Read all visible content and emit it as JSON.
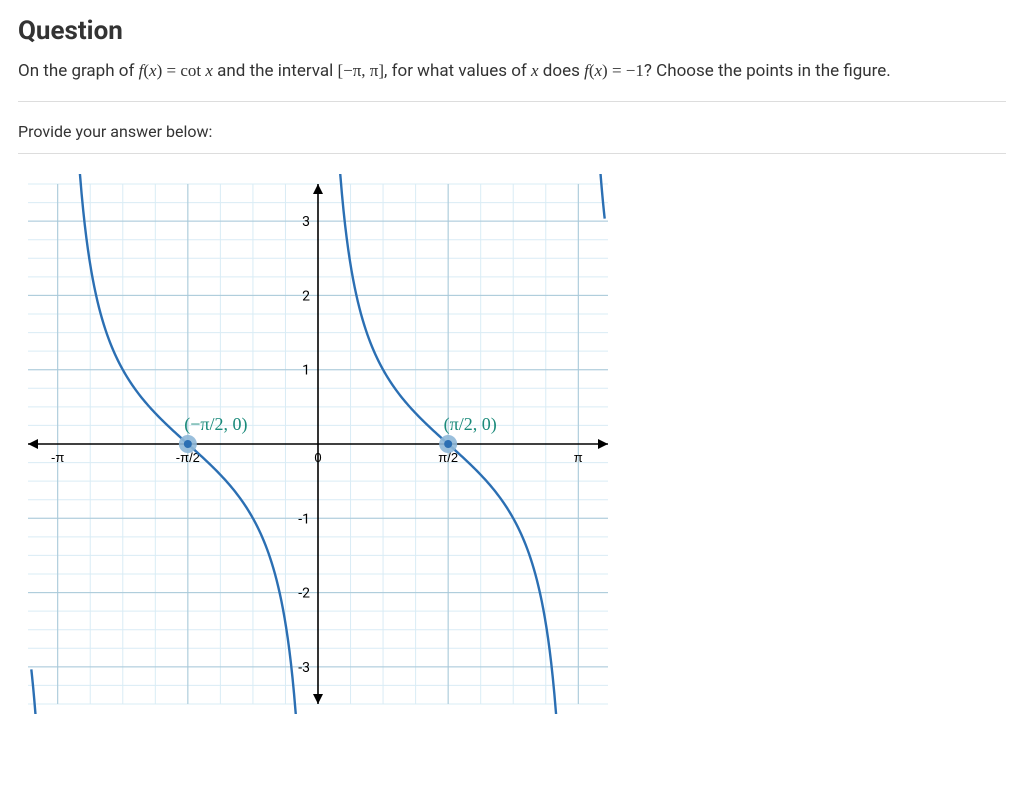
{
  "heading": "Question",
  "question_html": "On the graph of <span class='math'><span class='math-i'>f</span>(<span class='math-i'>x</span>) = cot <span class='math-i'>x</span></span> and the interval <span class='math'>[−π, π]</span>, for what values of <span class='math-i math'>x</span> does <span class='math'><span class='math-i'>f</span>(<span class='math-i'>x</span>) = −1</span>? Choose the points in the figure.",
  "prompt": "Provide your answer below:",
  "chart_data": {
    "type": "line",
    "function": "cot(x)",
    "x_range": [
      -3.5,
      3.5
    ],
    "y_range": [
      -3.5,
      3.5
    ],
    "x_ticks": [
      {
        "value": -3.14159,
        "label": "-π"
      },
      {
        "value": -1.5708,
        "label": "-π/2"
      },
      {
        "value": 0,
        "label": "0"
      },
      {
        "value": 1.5708,
        "label": "π/2"
      },
      {
        "value": 3.14159,
        "label": "π"
      }
    ],
    "y_ticks": [
      -3,
      -2,
      -1,
      1,
      2,
      3
    ],
    "asymptotes": [
      -3.14159,
      0,
      3.14159
    ],
    "highlighted_points": [
      {
        "x": -1.5708,
        "y": 0,
        "label": "(−π/2, 0)",
        "label_color": "#1a8a7a"
      },
      {
        "x": 1.5708,
        "y": 0,
        "label": "(π/2, 0)",
        "label_color": "#1a8a7a"
      }
    ],
    "curve_color": "#2b6fb3",
    "minor_grid_color": "#d9ecf5",
    "major_grid_color": "#a8c8d8",
    "axis_color": "#000000"
  }
}
